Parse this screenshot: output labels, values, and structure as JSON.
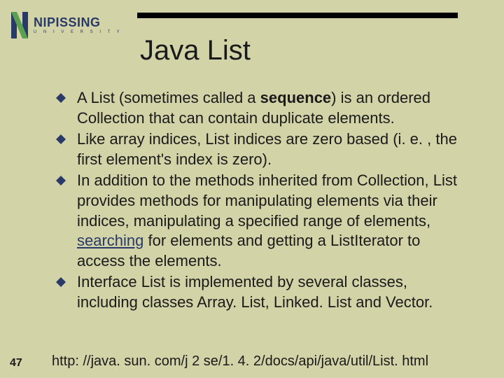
{
  "logo": {
    "main": "NIPISSING",
    "sub": "U N I V E R S I T Y"
  },
  "title": "Java List",
  "bullets": [
    {
      "pre": "A List (sometimes called a ",
      "bold": "sequence",
      "post": ") is an ordered Collection that can contain duplicate elements."
    },
    {
      "text": "Like array indices, List indices are zero based (i. e. , the first element's index is zero)."
    },
    {
      "pre": "In addition to the methods inherited from Collection, List provides methods for manipulating elements via their indices, manipulating a specified range of elements, ",
      "link": "searching",
      "post": " for elements and getting a ListIterator to access the elements."
    },
    {
      "text": "Interface List is implemented by several classes, including classes Array. List, Linked. List and Vector."
    }
  ],
  "slide_number": "47",
  "footer_url": "http: //java. sun. com/j 2 se/1. 4. 2/docs/api/java/util/List. html"
}
